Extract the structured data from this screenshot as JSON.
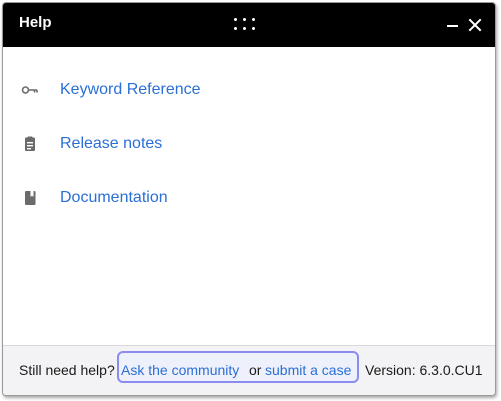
{
  "window": {
    "title": "Help"
  },
  "titlebar_icons": {
    "drag": "drag-handle-icon",
    "minimize": "minimize-icon",
    "close": "close-icon"
  },
  "menu": {
    "items": [
      {
        "label": "Keyword Reference",
        "icon": "key-icon"
      },
      {
        "label": "Release notes",
        "icon": "clipboard-icon"
      },
      {
        "label": "Documentation",
        "icon": "book-icon"
      }
    ]
  },
  "footer": {
    "prompt": "Still need help?",
    "community_link": "Ask the community",
    "connector": "or",
    "case_link": "submit a case",
    "version": "Version: 6.3.0.CU1"
  },
  "colors": {
    "titlebar_bg": "#000000",
    "link": "#2a6fd6",
    "focus_ring": "#8a8cf0",
    "footer_bg": "#f3f3f5"
  }
}
